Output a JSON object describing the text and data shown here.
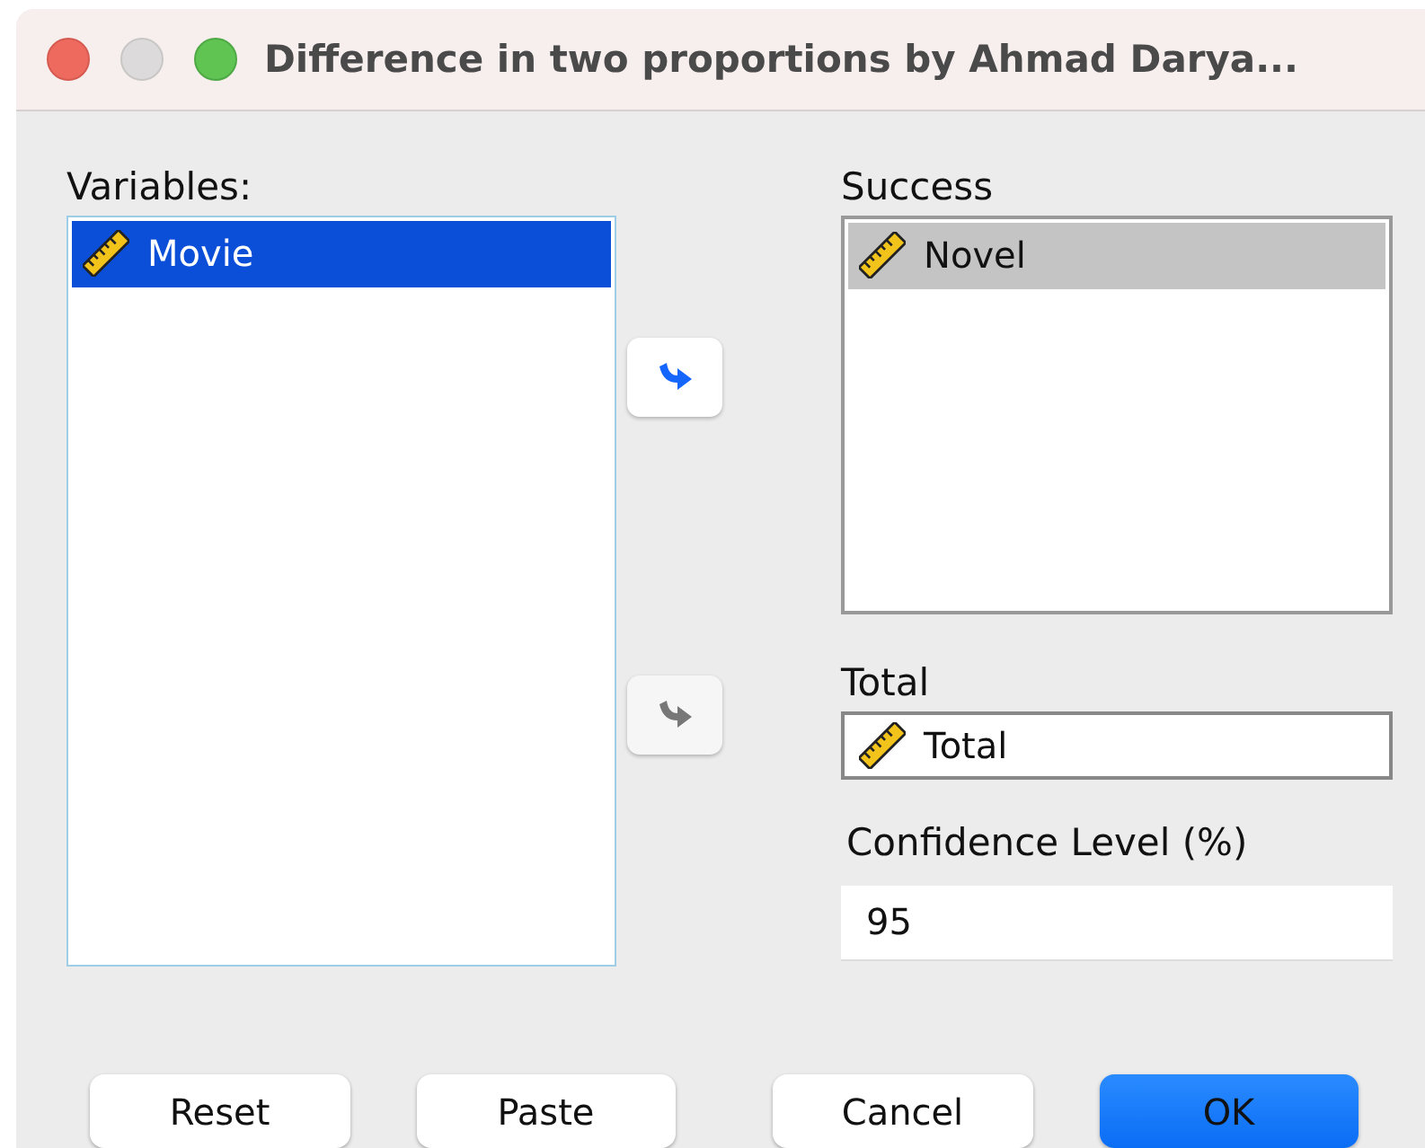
{
  "window": {
    "title": "Difference in two proportions by Ahmad Darya..."
  },
  "variables": {
    "label": "Variables:",
    "items": [
      {
        "name": "Movie",
        "selected": true
      }
    ]
  },
  "arrows": [
    {
      "disabled": false
    },
    {
      "disabled": true
    }
  ],
  "success": {
    "label": "Success",
    "items": [
      {
        "name": "Novel",
        "selected": true
      }
    ]
  },
  "total": {
    "label": "Total",
    "value": "Total"
  },
  "confidence": {
    "label": "Confidence Level (%)",
    "value": "95"
  },
  "buttons": [
    {
      "label": "Reset",
      "default": false
    },
    {
      "label": "Paste",
      "default": false
    },
    {
      "label": "Cancel",
      "default": false
    },
    {
      "label": "OK",
      "default": true
    }
  ]
}
